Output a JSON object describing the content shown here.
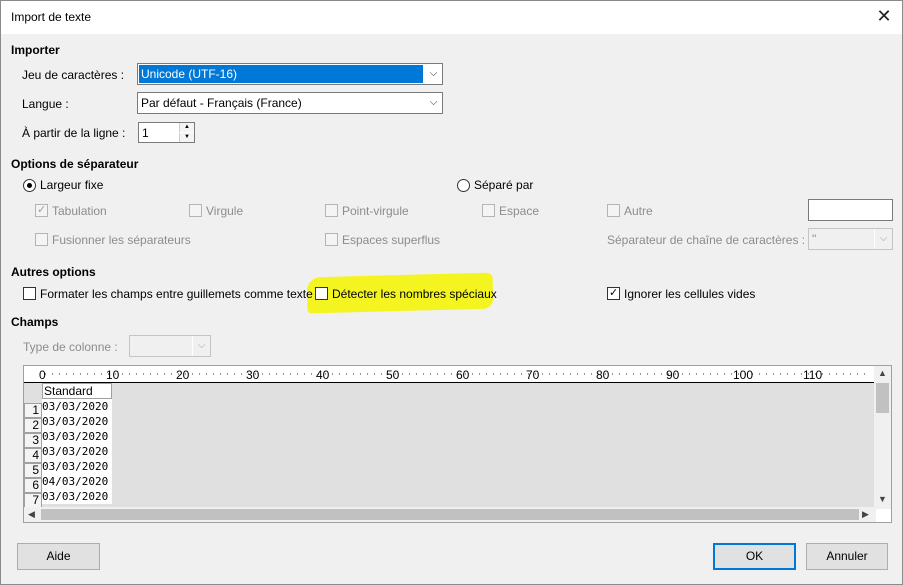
{
  "window": {
    "title": "Import de texte",
    "close_glyph": "✕"
  },
  "importer": {
    "heading": "Importer",
    "charset_label": "Jeu de caractères :",
    "charset_value": "Unicode (UTF-16)",
    "language_label": "Langue :",
    "language_value": "Par défaut - Français (France)",
    "from_line_label": "À partir de la ligne :",
    "from_line_value": "1"
  },
  "separator_options": {
    "heading": "Options de séparateur",
    "fixed_width_label": "Largeur fixe",
    "separated_by_label": "Séparé par",
    "tab_label": "Tabulation",
    "comma_label": "Virgule",
    "semicolon_label": "Point-virgule",
    "space_label": "Espace",
    "other_label": "Autre",
    "merge_label": "Fusionner les séparateurs",
    "trim_label": "Espaces superflus",
    "string_delim_label": "Séparateur de chaîne de caractères :",
    "string_delim_value": "\""
  },
  "other_options": {
    "heading": "Autres options",
    "quoted_as_text_label": "Formater les champs entre guillemets comme texte",
    "detect_special_label": "Détecter les nombres spéciaux",
    "skip_empty_label": "Ignorer les cellules vides"
  },
  "fields": {
    "heading": "Champs",
    "column_type_label": "Type de colonne :",
    "ruler_ticks": [
      "0",
      "10",
      "20",
      "30",
      "40",
      "50",
      "60",
      "70",
      "80",
      "90",
      "100",
      "110"
    ],
    "column_header": "Standard",
    "rows": [
      {
        "num": "1",
        "value": "03/03/2020"
      },
      {
        "num": "2",
        "value": "03/03/2020"
      },
      {
        "num": "3",
        "value": "03/03/2020"
      },
      {
        "num": "4",
        "value": "03/03/2020"
      },
      {
        "num": "5",
        "value": "03/03/2020"
      },
      {
        "num": "6",
        "value": "04/03/2020"
      },
      {
        "num": "7",
        "value": "03/03/2020"
      }
    ]
  },
  "buttons": {
    "help": "Aide",
    "ok": "OK",
    "cancel": "Annuler"
  },
  "colors": {
    "selection": "#0078d7",
    "highlight": "#f4f421",
    "default_button_border": "#0078d7"
  }
}
